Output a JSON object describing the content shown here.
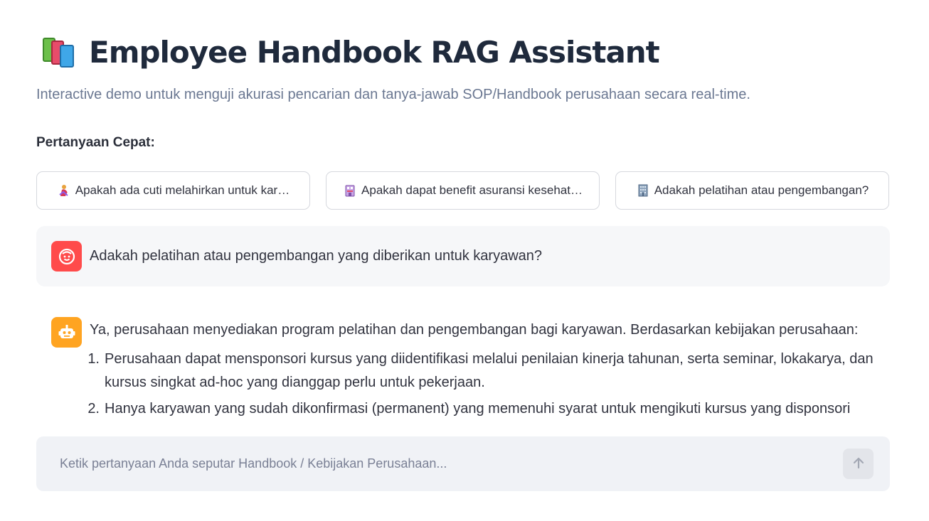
{
  "header": {
    "title": "Employee Handbook RAG Assistant",
    "title_icon": "books-icon",
    "subtitle": "Interactive demo untuk menguji akurasi pencarian dan tanya-jawab SOP/Handbook perusahaan secara real-time."
  },
  "quick_questions": {
    "label": "Pertanyaan Cepat:",
    "items": [
      {
        "icon": "pregnant-woman-icon",
        "label": "Apakah ada cuti melahirkan untuk kar…"
      },
      {
        "icon": "hospital-icon",
        "label": "Apakah dapat benefit asuransi kesehat…"
      },
      {
        "icon": "building-icon",
        "label": "Adakah pelatihan atau pengembangan?"
      }
    ]
  },
  "chat": {
    "messages": [
      {
        "role": "user",
        "avatar_icon": "user-avatar-icon",
        "avatar_color": "#ff4b4b",
        "text": "Adakah pelatihan atau pengembangan yang diberikan untuk karyawan?"
      },
      {
        "role": "assistant",
        "avatar_icon": "bot-avatar-icon",
        "avatar_color": "#ffa421",
        "intro": "Ya, perusahaan menyediakan program pelatihan dan pengembangan bagi karyawan. Berdasarkan kebijakan perusahaan:",
        "list": [
          {
            "num": "1.",
            "text": "Perusahaan dapat mensponsori kursus yang diidentifikasi melalui penilaian kinerja tahunan, serta seminar, lokakarya, dan kursus singkat ad-hoc yang dianggap perlu untuk pekerjaan."
          },
          {
            "num": "2.",
            "text": "Hanya karyawan yang sudah dikonfirmasi (permanent) yang memenuhi syarat untuk mengikuti kursus yang disponsori"
          }
        ]
      }
    ]
  },
  "input": {
    "placeholder": "Ketik pertanyaan Anda seputar Handbook / Kebijakan Perusahaan...",
    "value": "",
    "send_icon": "arrow-up-icon"
  },
  "colors": {
    "user_avatar": "#ff4b4b",
    "bot_avatar": "#ffa421",
    "title": "#1f2a3c",
    "subtitle": "#6b7892"
  }
}
